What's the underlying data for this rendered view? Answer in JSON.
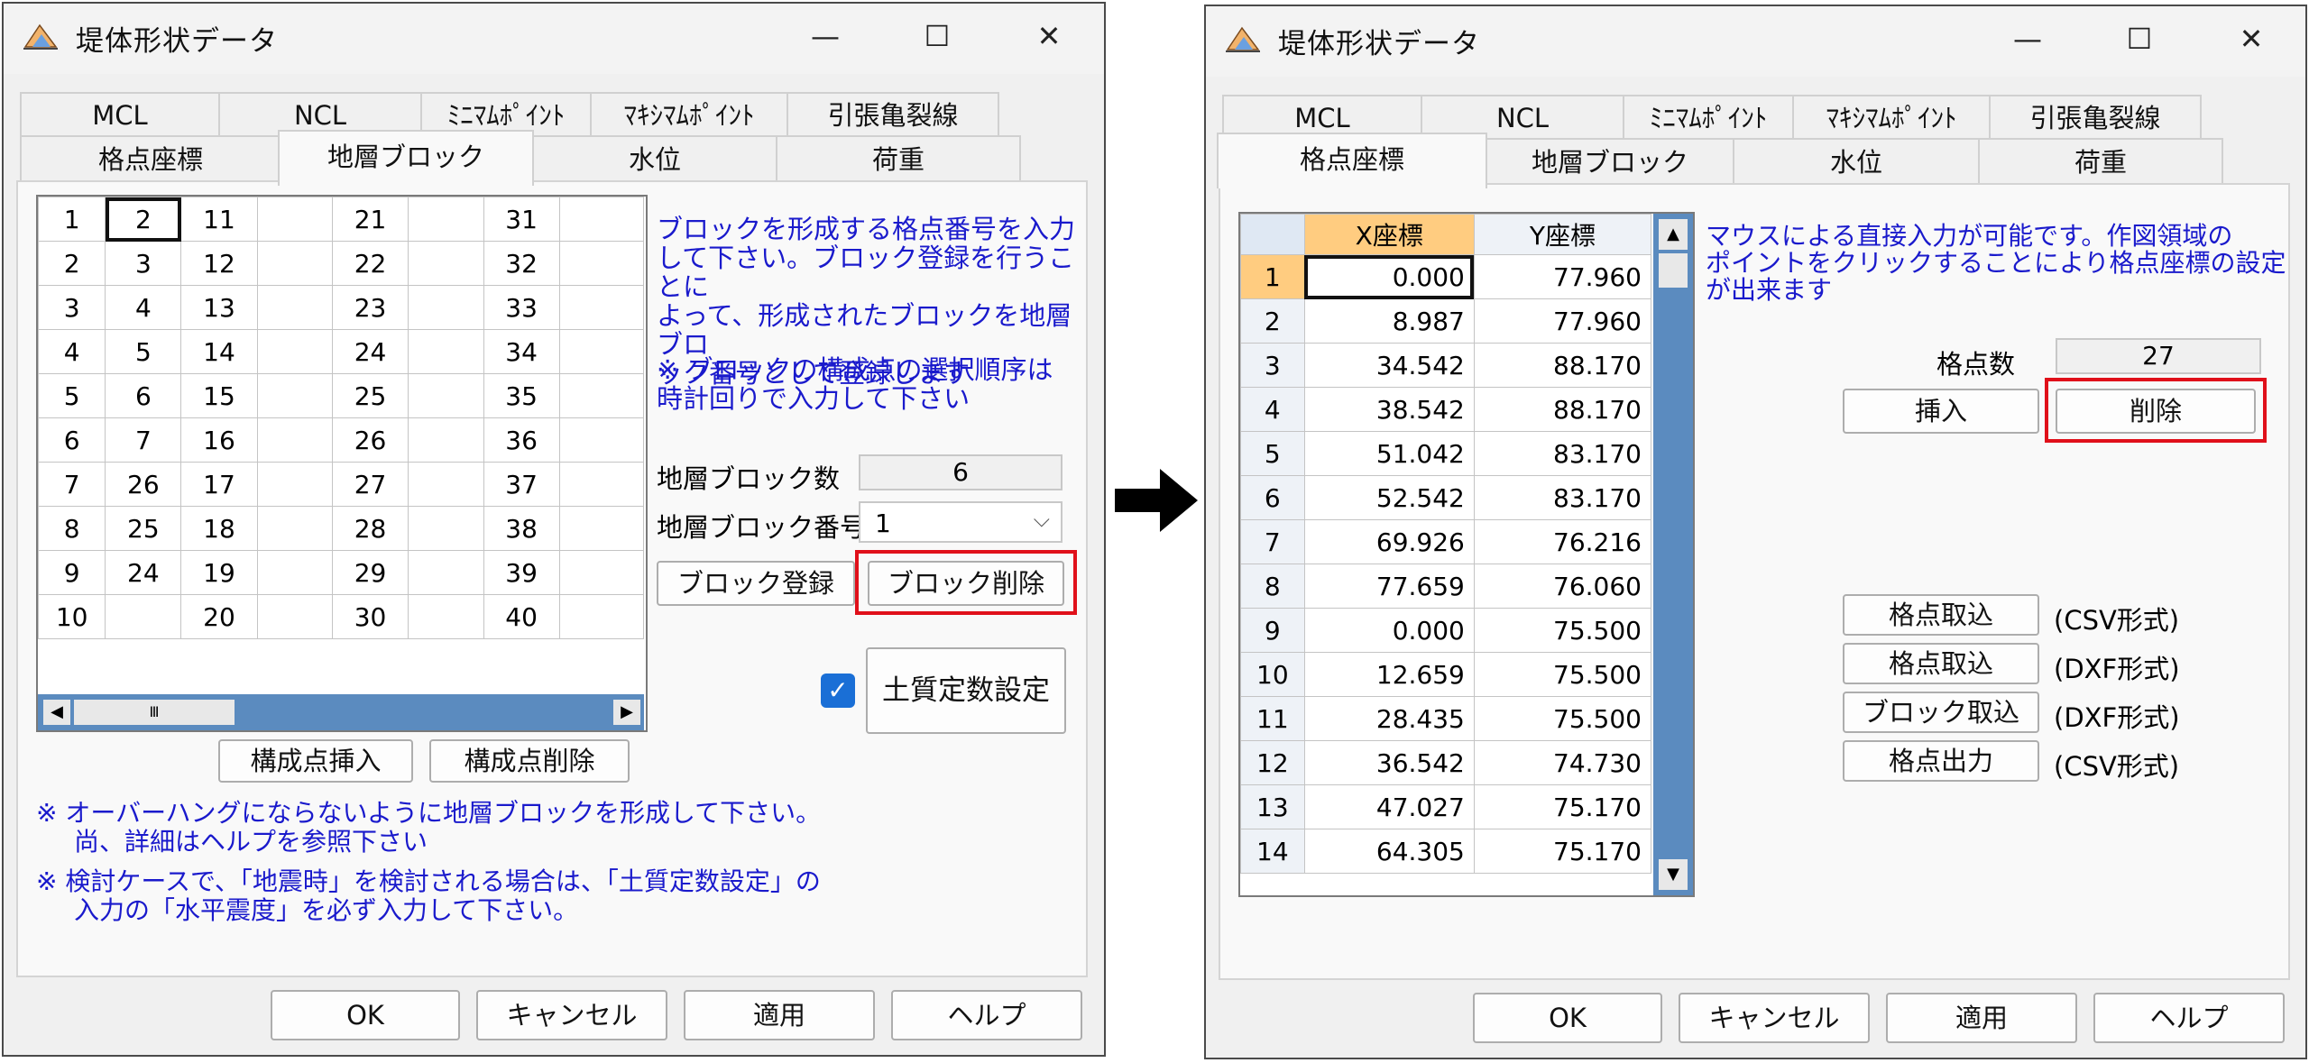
{
  "left_window": {
    "title": "堤体形状データ",
    "tabs_top": [
      "MCL",
      "NCL",
      "ﾐﾆﾏﾑﾎﾟｲﾝﾄ",
      "ﾏｷｼﾏﾑﾎﾟｲﾝﾄ",
      "引張亀裂線"
    ],
    "tabs_bottom": [
      "格点座標",
      "地層ブロック",
      "水位",
      "荷重"
    ],
    "selected_tab": "地層ブロック",
    "grid_rows": [
      [
        "1",
        "2",
        "11",
        "",
        "21",
        "",
        "31",
        ""
      ],
      [
        "2",
        "3",
        "12",
        "",
        "22",
        "",
        "32",
        ""
      ],
      [
        "3",
        "4",
        "13",
        "",
        "23",
        "",
        "33",
        ""
      ],
      [
        "4",
        "5",
        "14",
        "",
        "24",
        "",
        "34",
        ""
      ],
      [
        "5",
        "6",
        "15",
        "",
        "25",
        "",
        "35",
        ""
      ],
      [
        "6",
        "7",
        "16",
        "",
        "26",
        "",
        "36",
        ""
      ],
      [
        "7",
        "26",
        "17",
        "",
        "27",
        "",
        "37",
        ""
      ],
      [
        "8",
        "25",
        "18",
        "",
        "28",
        "",
        "38",
        ""
      ],
      [
        "9",
        "24",
        "19",
        "",
        "29",
        "",
        "39",
        ""
      ],
      [
        "10",
        "",
        "20",
        "",
        "30",
        "",
        "40",
        ""
      ]
    ],
    "info_line1": "ブロックを形成する格点番号を入力",
    "info_line2": "して下さい。ブロック登録を行うことに",
    "info_line3": "よって、形成されたブロックを地層ブロ",
    "info_line4": "ック番号として登録します",
    "note_line1": "※ ブロックの構成点の選択順序は",
    "note_line2": "時計回りで入力して下さい",
    "count_label": "地層ブロック数",
    "count_value": "6",
    "number_label": "地層ブロック番号",
    "number_value": "1",
    "register_button": "ブロック登録",
    "delete_button": "ブロック削除",
    "soil_checkbox_checked": true,
    "soil_button": "土質定数設定",
    "insert_point_button": "構成点挿入",
    "delete_point_button": "構成点削除",
    "bottom_note1_l1": "※ オーバーハングにならないように地層ブロックを形成して下さい。",
    "bottom_note1_l2": "尚、詳細はヘルプを参照下さい",
    "bottom_note2_l1": "※ 検討ケースで、「地震時」を検討される場合は、「土質定数設定」の",
    "bottom_note2_l2": "入力の「水平震度」を必ず入力して下さい。",
    "footer_buttons": [
      "OK",
      "キャンセル",
      "適用",
      "ヘルプ"
    ]
  },
  "right_window": {
    "title": "堤体形状データ",
    "tabs_top": [
      "MCL",
      "NCL",
      "ﾐﾆﾏﾑﾎﾟｲﾝﾄ",
      "ﾏｷｼﾏﾑﾎﾟｲﾝﾄ",
      "引張亀裂線"
    ],
    "tabs_bottom": [
      "格点座標",
      "地層ブロック",
      "水位",
      "荷重"
    ],
    "selected_tab": "格点座標",
    "col_x": "X座標",
    "col_y": "Y座標",
    "rows": [
      {
        "n": "1",
        "x": "0.000",
        "y": "77.960"
      },
      {
        "n": "2",
        "x": "8.987",
        "y": "77.960"
      },
      {
        "n": "3",
        "x": "34.542",
        "y": "88.170"
      },
      {
        "n": "4",
        "x": "38.542",
        "y": "88.170"
      },
      {
        "n": "5",
        "x": "51.042",
        "y": "83.170"
      },
      {
        "n": "6",
        "x": "52.542",
        "y": "83.170"
      },
      {
        "n": "7",
        "x": "69.926",
        "y": "76.216"
      },
      {
        "n": "8",
        "x": "77.659",
        "y": "76.060"
      },
      {
        "n": "9",
        "x": "0.000",
        "y": "75.500"
      },
      {
        "n": "10",
        "x": "12.659",
        "y": "75.500"
      },
      {
        "n": "11",
        "x": "28.435",
        "y": "75.500"
      },
      {
        "n": "12",
        "x": "36.542",
        "y": "74.730"
      },
      {
        "n": "13",
        "x": "47.027",
        "y": "75.170"
      },
      {
        "n": "14",
        "x": "64.305",
        "y": "75.170"
      }
    ],
    "info_line1": "マウスによる直接入力が可能です。作図領域の",
    "info_line2": "ポイントをクリックすることにより格点座標の設定",
    "info_line3": "が出来ます",
    "count_label": "格点数",
    "count_value": "27",
    "insert_button": "挿入",
    "delete_button": "削除",
    "import_buttons": [
      {
        "label": "格点取込",
        "format": "(CSV形式)"
      },
      {
        "label": "格点取込",
        "format": "(DXF形式)"
      },
      {
        "label": "ブロック取込",
        "format": "(DXF形式)"
      },
      {
        "label": "格点出力",
        "format": "(CSV形式)"
      }
    ],
    "footer_buttons": [
      "OK",
      "キャンセル",
      "適用",
      "ヘルプ"
    ]
  },
  "colors": {
    "highlight": "#e0101a",
    "info_text": "#1a1acc",
    "header_orange": "#ffcc80",
    "scroll_blue": "#9ab8d8"
  }
}
